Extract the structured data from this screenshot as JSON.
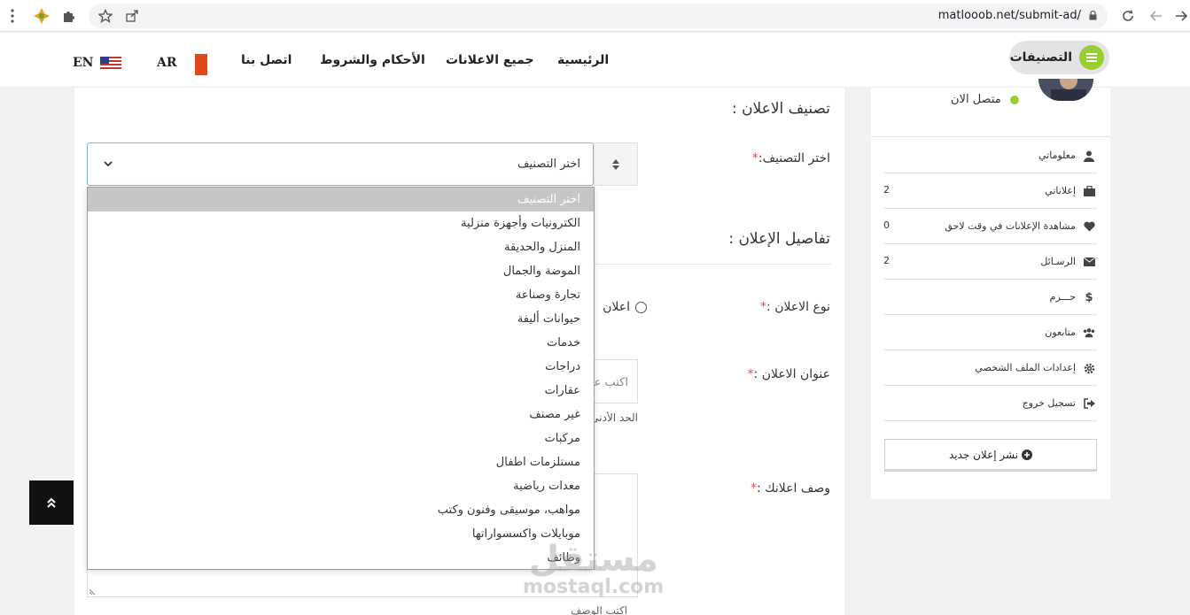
{
  "browser": {
    "url": "matlooob.net/submit-ad/"
  },
  "header": {
    "categories_button": "التصنيفات",
    "nav": [
      "الرئيسية",
      "جميع الاعلانات",
      "الأحكام والشروط",
      "اتصل بنا"
    ],
    "lang_ar": "AR",
    "lang_en": "EN"
  },
  "form": {
    "section_category": "تصنيف الاعلان :",
    "choose_category_label": "اختر التصنيف:",
    "select_value": "اختر التصنيف",
    "section_details": "تفاصيل الإعلان :",
    "ad_type_label": "نوع الاعلان :",
    "ad_type_option": "اعلان",
    "ad_title_label": "عنوان الاعلان :",
    "ad_title_placeholder": "اكتب عنوان",
    "min_hint": "الحد الأدنى",
    "description_label": "وصف اعلانك :",
    "description_hint": "اكتب الوصف",
    "required_mark": "*"
  },
  "dropdown_options": [
    "اختر التصنيف",
    "الكترونيات وأجهزة منزلية",
    "المنزل والحديقة",
    "الموضة والجمال",
    "تجارة وصناعة",
    "حيوانات أليفة",
    "خدمات",
    "دراجات",
    "عقارات",
    "غير مصنف",
    "مركبات",
    "مستلزمات اطفال",
    "معدات رياضية",
    "مواهب، موسيقى وفنون وكتب",
    "موبايلات واكسسواراتها",
    "وظائف"
  ],
  "sidebar": {
    "status": "متصل الان",
    "items": [
      {
        "label": "معلوماتي",
        "count": "",
        "icon": "user-icon"
      },
      {
        "label": "إعلاناتي",
        "count": "2",
        "icon": "briefcase-icon"
      },
      {
        "label": "مشاهدة الإعلانات في وقت لاحق",
        "count": "0",
        "icon": "heart-icon"
      },
      {
        "label": "الرسـائل",
        "count": "2",
        "icon": "envelope-icon"
      },
      {
        "label": "حـــزم",
        "count": "",
        "icon": "dollar-icon"
      },
      {
        "label": "متابعون",
        "count": "",
        "icon": "users-icon"
      },
      {
        "label": "إعدادات الملف الشخصي",
        "count": "",
        "icon": "gear-icon"
      },
      {
        "label": "تسجيل خروج",
        "count": "",
        "icon": "logout-icon"
      }
    ],
    "post_button": "نشر إعلان جديد"
  },
  "watermark": {
    "ar": "مستقل",
    "latin": "mostaql.com"
  },
  "colors": {
    "accent_green": "#9acd32",
    "required_red": "#d9534f",
    "select_border": "#7db4e8"
  }
}
